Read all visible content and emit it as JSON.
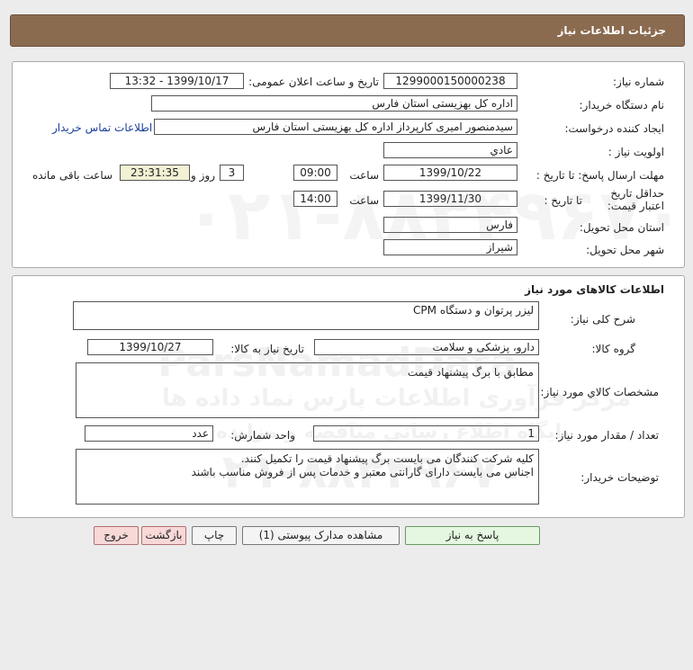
{
  "header": {
    "title": "جزئیات اطلاعات نیاز"
  },
  "info": {
    "need_number_label": "شماره نیاز:",
    "need_number": "1299000150000238",
    "announce_label": "تاریخ و ساعت اعلان عمومی:",
    "announce_value": "1399/10/17 - 13:32",
    "buyer_label": "نام دستگاه خریدار:",
    "buyer_value": "اداره کل بهزیستی استان فارس",
    "requester_label": "ایجاد کننده درخواست:",
    "requester_value": "سیدمنصور امیری کارپرداز اداره کل بهزیستی استان فارس",
    "contact_link": "اطلاعات تماس خریدار",
    "priority_label": "اولویت نیاز :",
    "priority_value": "عادي",
    "deadline_label": "مهلت ارسال پاسخ: تا تاریخ :",
    "deadline_date": "1399/10/22",
    "time_label": "ساعت",
    "deadline_time": "09:00",
    "days_value": "3",
    "days_label": "روز و",
    "remaining_time": "23:31:35",
    "remaining_label": "ساعت باقی مانده",
    "validity_label": "حداقل تاریخ اعتبار قیمت:",
    "validity_sub_label": "تا تاریخ :",
    "validity_date": "1399/11/30",
    "validity_time": "14:00",
    "province_label": "استان محل تحویل:",
    "province_value": "فارس",
    "city_label": "شهر محل تحویل:",
    "city_value": "شیراز"
  },
  "goods": {
    "section_title": "اطلاعات کالاهای مورد نیاز",
    "desc_label": "شرح کلی نیاز:",
    "desc_value": "لیزر پرتوان و دستگاه CPM",
    "group_label": "گروه کالا:",
    "group_value": "دارو، پزشکی و سلامت",
    "need_date_label": "تاریخ نیاز به کالا:",
    "need_date_value": "1399/10/27",
    "specs_label": "مشخصات کالاي مورد نیاز:",
    "specs_value": "مطابق با برگ پیشنهاد قیمت",
    "qty_label": "تعداد / مقدار مورد نیاز:",
    "qty_value": "1",
    "unit_label": "واحد شمارش:",
    "unit_value": "عدد",
    "notes_label": "توضیحات خریدار:",
    "notes_value": "کلیه شرکت کنندگان می بایست برگ پیشنهاد قیمت را تکمیل کنند.\nاجناس می بایست دارای گارانتی معتبر و خدمات پس از فروش مناسب باشند"
  },
  "buttons": {
    "reply": "پاسخ به نیاز",
    "attachments": "مشاهده مدارک پیوستی (1)",
    "print": "چاپ",
    "back": "بازگشت",
    "exit": "خروج"
  },
  "watermark": {
    "latin": "ParsNamadData",
    "fa_line1": "مرکز فرآوری اطلاعات پارس نماد داده ها",
    "fa_line2": "پایگاه اطلاع رسانی مناقصه و مزایده",
    "phone": "۰۲۱-۸۸۳۴۹۶۷۰"
  },
  "colors": {
    "header_bg": "#8b6b50",
    "link": "#1a3e9c",
    "remain_bg": "#f2f1d4",
    "reply_btn": "#e5f7e0",
    "exit_btn": "#f9d8d8"
  }
}
